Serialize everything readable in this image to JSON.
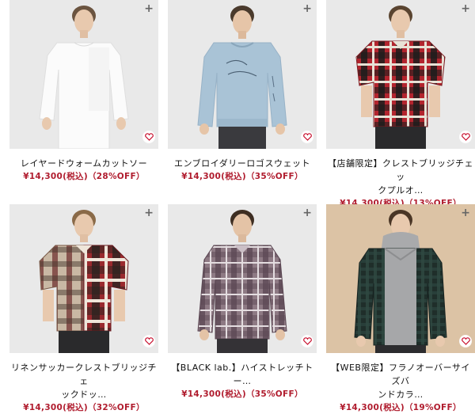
{
  "colors": {
    "price": "#b01c2e",
    "heart": "#c8102e"
  },
  "icons": {
    "add": "plus-icon",
    "favorite": "heart-icon"
  },
  "products": [
    {
      "name_line1": "レイヤードウォームカットソー",
      "name_line2": "",
      "price": "¥14,300(税込)",
      "discount": "（28%OFF）",
      "shirt_style": "white-longsleeve",
      "background": "#e9e9e9"
    },
    {
      "name_line1": "エンブロイダリーロゴスウェット",
      "name_line2": "",
      "price": "¥14,300(税込)",
      "discount": "（35%OFF）",
      "shirt_style": "light-blue-sweat",
      "background": "#e9e9e9"
    },
    {
      "name_line1": "【店舗限定】クレストブリッジチェッ",
      "name_line2": "クプルオ…",
      "price": "¥14,300(税込)",
      "discount": "（13%OFF）",
      "shirt_style": "red-check-halfsleeve",
      "background": "#e9e9e9"
    },
    {
      "name_line1": "リネンサッカークレストブリッジチェ",
      "name_line2": "ックドッ…",
      "price": "¥14,300(税込)",
      "discount": "（32%OFF）",
      "shirt_style": "red-patchwork-check",
      "background": "#e9e9e9"
    },
    {
      "name_line1": "【BLACK lab.】ハイストレッチト",
      "name_line2": "ー…",
      "price": "¥14,300(税込)",
      "discount": "（35%OFF）",
      "shirt_style": "mauve-check-longsleeve",
      "background": "#e9e9e9"
    },
    {
      "name_line1": "【WEB限定】フラノオーバーサイズバ",
      "name_line2": "ンドカラ…",
      "price": "¥14,300(税込)",
      "discount": "（19%OFF）",
      "shirt_style": "dark-green-check-with-hoodie",
      "background": "#dcc3a5"
    }
  ]
}
